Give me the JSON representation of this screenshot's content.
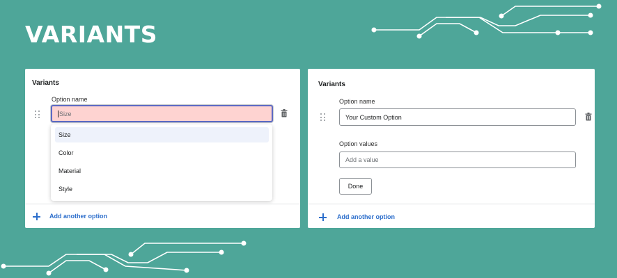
{
  "page": {
    "title": "VARIANTS"
  },
  "left_panel": {
    "title": "Variants",
    "option_label": "Option name",
    "option_value": "Size",
    "dropdown_options": [
      {
        "label": "Size",
        "selected": true
      },
      {
        "label": "Color",
        "selected": false
      },
      {
        "label": "Material",
        "selected": false
      },
      {
        "label": "Style",
        "selected": false
      }
    ],
    "add_option_label": "Add another option"
  },
  "right_panel": {
    "title": "Variants",
    "option_label": "Option name",
    "option_value": "Your Custom Option",
    "values_label": "Option values",
    "values_placeholder": "Add a value",
    "done_label": "Done",
    "add_option_label": "Add another option"
  },
  "colors": {
    "background": "#4ea699",
    "error_field": "#fed3d1",
    "focus_border": "#5c6ac4",
    "link": "#2c6ecb"
  }
}
